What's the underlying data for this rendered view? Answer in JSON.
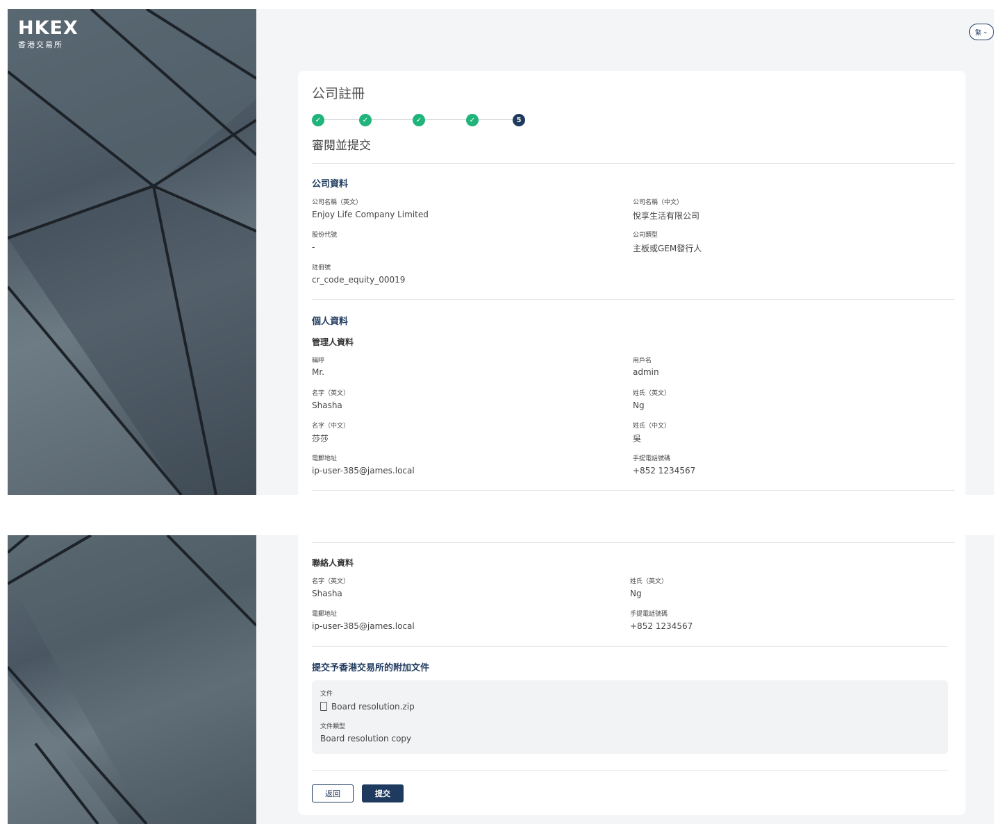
{
  "brand": {
    "logo_text": "HKEX",
    "logo_sub": "香港交易所"
  },
  "lang_toggle": {
    "label": "繁",
    "icon": "chevron-down-icon"
  },
  "page": {
    "title": "公司註冊",
    "step_title": "審閱並提交"
  },
  "stepper": {
    "steps": [
      "done",
      "done",
      "done",
      "done",
      "5"
    ],
    "current": "5"
  },
  "company": {
    "heading": "公司資料",
    "name_en_label": "公司名稱（英文）",
    "name_en": "Enjoy Life Company Limited",
    "name_zh_label": "公司名稱（中文）",
    "name_zh": "悅享生活有限公司",
    "stock_code_label": "股份代號",
    "stock_code": "-",
    "company_type_label": "公司類型",
    "company_type": "主板或GEM發行人",
    "cr_label": "註冊號",
    "cr": "cr_code_equity_00019"
  },
  "personal": {
    "heading": "個人資料",
    "admin_heading": "管理人資料",
    "title_label": "稱呼",
    "title": "Mr.",
    "username_label": "用戶名",
    "username": "admin",
    "first_en_label": "名字（英文）",
    "first_en": "Shasha",
    "last_en_label": "姓氏（英文）",
    "last_en": "Ng",
    "first_zh_label": "名字（中文）",
    "first_zh": "莎莎",
    "last_zh_label": "姓氏（中文）",
    "last_zh": "吳",
    "email_label": "電郵地址",
    "email": "ip-user-385@james.local",
    "mobile_label": "手提電話號碼",
    "mobile": "+852 1234567"
  },
  "contact": {
    "heading": "聯絡人資料",
    "first_en_label": "名字（英文）",
    "first_en": "Shasha",
    "last_en_label": "姓氏（英文）",
    "last_en": "Ng",
    "email_label": "電郵地址",
    "email": "ip-user-385@james.local",
    "mobile_label": "手提電話號碼",
    "mobile": "+852 1234567"
  },
  "documents": {
    "heading": "提交予香港交易所的附加文件",
    "file_label": "文件",
    "file_name": "Board resolution.zip",
    "type_label": "文件類型",
    "type": "Board resolution copy"
  },
  "actions": {
    "back": "返回",
    "submit": "提交"
  }
}
